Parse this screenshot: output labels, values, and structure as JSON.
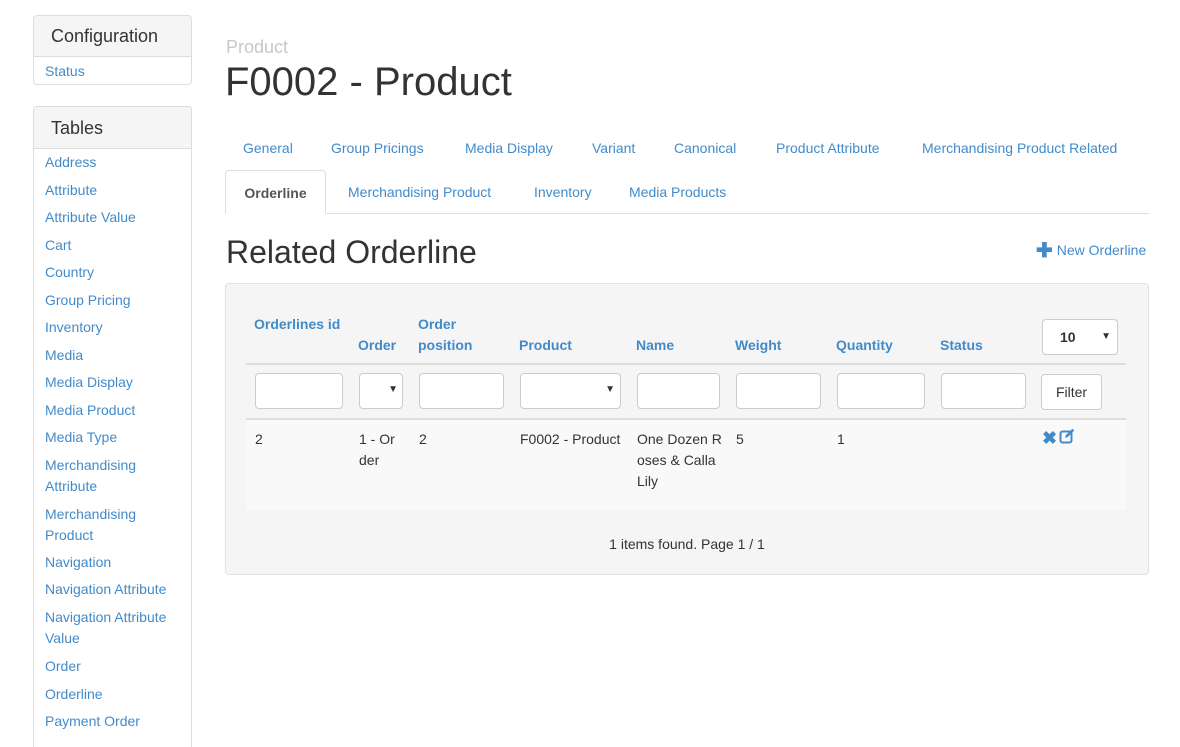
{
  "sidebar": {
    "config_heading": "Configuration",
    "config_items": [
      "Status"
    ],
    "tables_heading": "Tables",
    "tables_items": [
      "Address",
      "Attribute",
      "Attribute Value",
      "Cart",
      "Country",
      "Group Pricing",
      "Inventory",
      "Media",
      "Media Display",
      "Media Product",
      "Media Type",
      "Merchandising Attribute",
      "Merchandising Product",
      "Navigation",
      "Navigation Attribute",
      "Navigation Attribute Value",
      "Order",
      "Orderline",
      "Payment Order"
    ]
  },
  "header": {
    "subtitle": "Product",
    "title": "F0002 - Product"
  },
  "tabs": {
    "row1": [
      "General",
      "Group Pricings",
      "Media Display",
      "Variant",
      "Canonical",
      "Product Attribute",
      "Merchandising Product Related"
    ],
    "active": "Orderline",
    "row2": [
      "Merchandising Product",
      "Inventory",
      "Media Products"
    ]
  },
  "section": {
    "title": "Related Orderline",
    "new_label": "New Orderline"
  },
  "table": {
    "columns": [
      "Orderlines id",
      "Order position",
      "Order",
      "Product",
      "Name",
      "Weight",
      "Quantity",
      "Status"
    ],
    "per_page": "10",
    "filter_label": "Filter",
    "rows": [
      {
        "id": "2",
        "order": "1 - Order",
        "position": "2",
        "product": "F0002 - Product",
        "name": "One Dozen Roses & Calla Lily",
        "weight": "5",
        "quantity": "1",
        "status": ""
      }
    ],
    "footer": "1 items found. Page 1 / 1"
  },
  "colors": {
    "link": "#428bca",
    "well": "#f5f5f5",
    "row": "#f9f9f9"
  }
}
